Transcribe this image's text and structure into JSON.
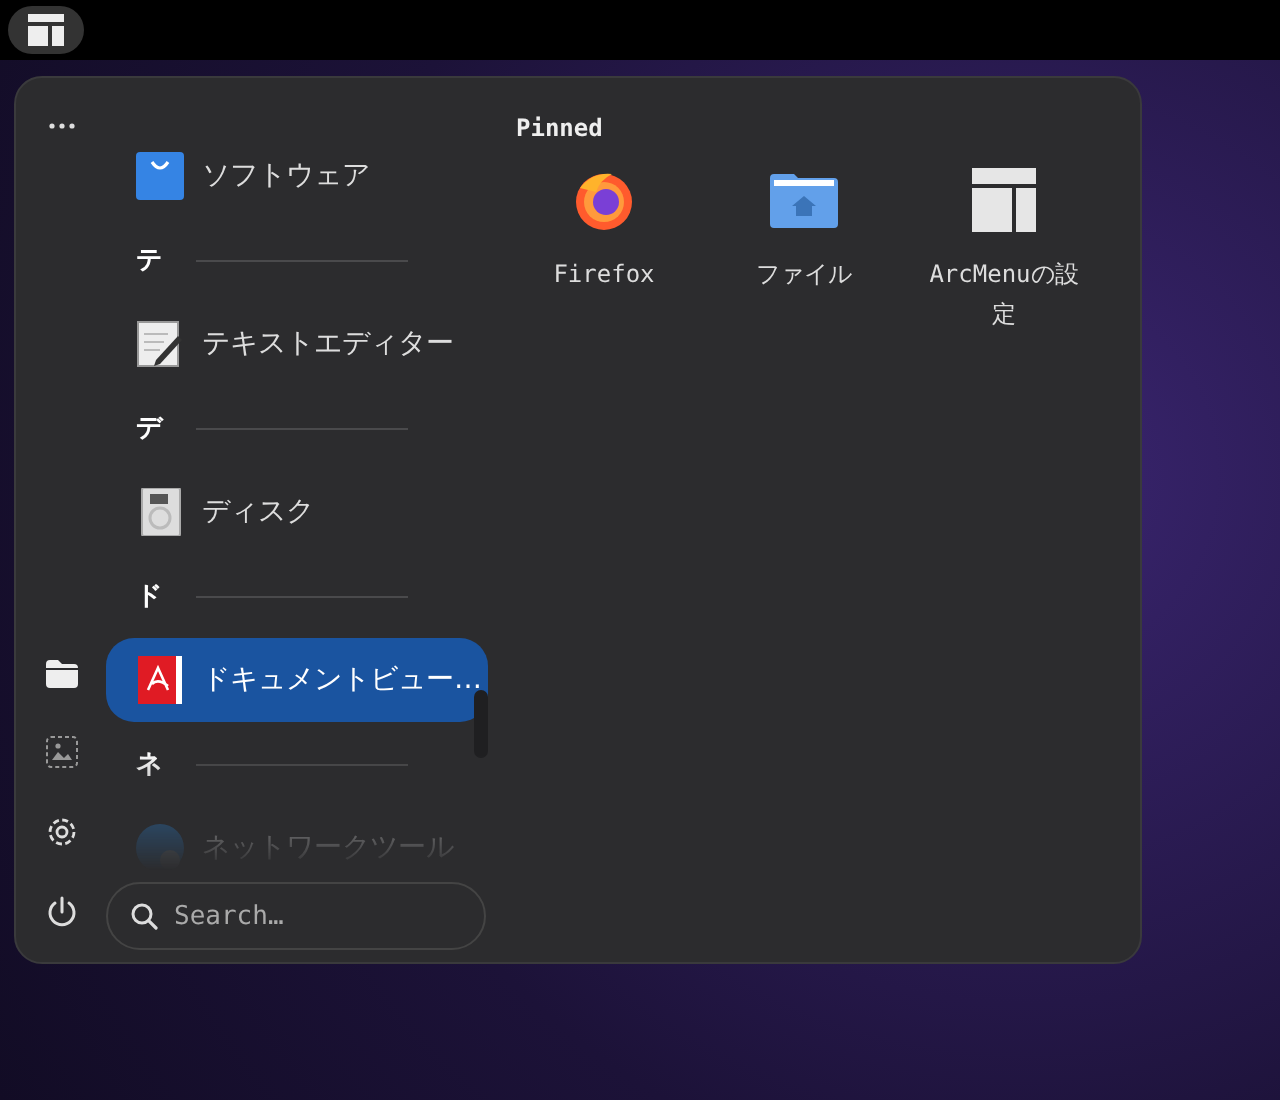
{
  "app_list": [
    {
      "kind": "app",
      "label": "ソフトウェア",
      "selected": false
    },
    {
      "kind": "header",
      "label": "テ"
    },
    {
      "kind": "app",
      "label": "テキストエディター",
      "selected": false
    },
    {
      "kind": "header",
      "label": "デ"
    },
    {
      "kind": "app",
      "label": "ディスク",
      "selected": false
    },
    {
      "kind": "header",
      "label": "ド"
    },
    {
      "kind": "app",
      "label": "ドキュメントビュー…",
      "selected": true
    },
    {
      "kind": "header",
      "label": "ネ"
    },
    {
      "kind": "app",
      "label": "ネットワークツール",
      "selected": false
    }
  ],
  "search": {
    "placeholder": "Search…"
  },
  "pinned": {
    "title": "Pinned",
    "items": [
      {
        "label": "Firefox"
      },
      {
        "label": "ファイル"
      },
      {
        "label": "ArcMenuの設定"
      }
    ]
  }
}
